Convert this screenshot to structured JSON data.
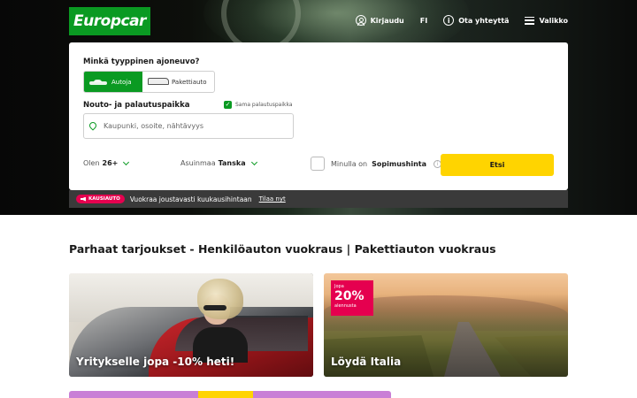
{
  "brand": {
    "logo_text": "Europcar",
    "accent": "#0a9a22",
    "cta": "#ffd400",
    "promo_pink": "#e5004f"
  },
  "topnav": {
    "login": "Kirjaudu",
    "language": "FI",
    "contact": "Ota yhteyttä",
    "menu": "Valikko"
  },
  "search": {
    "vehicle_question": "Minkä tyyppinen ajoneuvo?",
    "vehicle_types": [
      {
        "label": "Autoja",
        "selected": true,
        "icon": "car-icon"
      },
      {
        "label": "Pakettiauto",
        "selected": false,
        "icon": "van-icon"
      }
    ],
    "pickup_label": "Nouto- ja palautuspaikka",
    "same_return_label": "Sama palautuspaikka",
    "same_return_checked": true,
    "location_placeholder": "Kaupunki, osoite, nähtävyys",
    "age_prefix": "Olen",
    "age_value": "26+",
    "residence_prefix": "Asuinmaa",
    "residence_value": "Tanska",
    "contract_prefix": "Minulla on",
    "contract_value": "Sopimushinta",
    "contract_checked": false,
    "submit_label": "Etsi"
  },
  "promo": {
    "badge": "KAUSIAUTO",
    "text": "Vuokraa joustavasti kuukausihintaan",
    "link": "Tilaa nyt"
  },
  "offers": {
    "title": "Parhaat tarjoukset - Henkilöauton vuokraus | Pakettiauton vuokraus",
    "tiles": [
      {
        "title": "Yritykselle jopa -10% heti!"
      },
      {
        "title": "Löydä Italia",
        "badge_pre": "Jopa",
        "badge_value": "20%",
        "badge_post": "alennusta"
      }
    ]
  }
}
